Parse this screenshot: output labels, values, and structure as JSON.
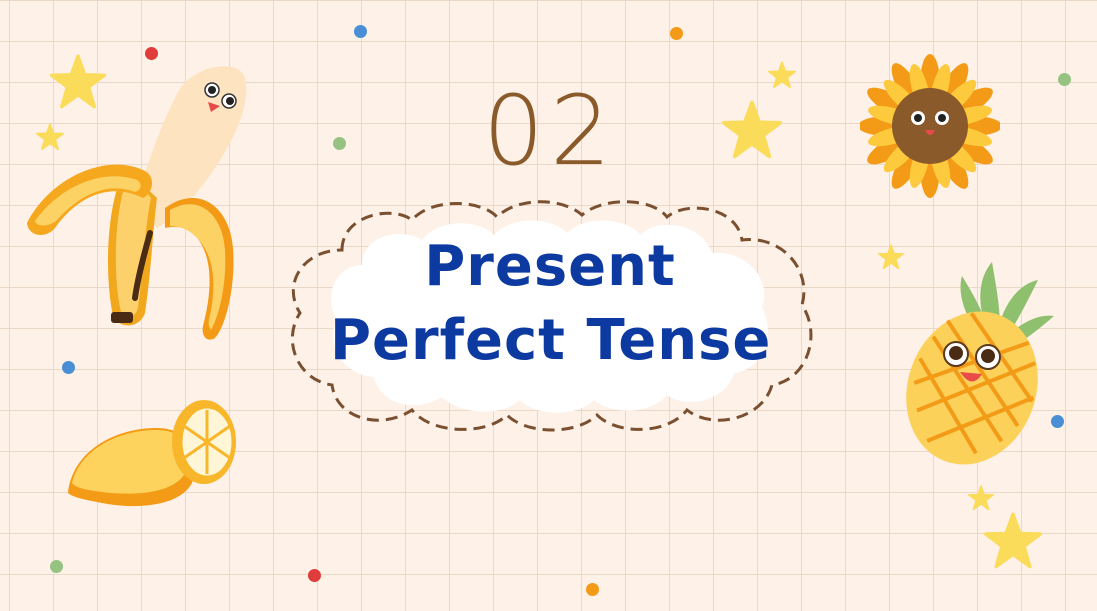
{
  "slide": {
    "section_number": "02",
    "title_line_1": "Present",
    "title_line_2": "Perfect Tense"
  },
  "colors": {
    "background": "#fdf1e8",
    "grid_line": "#ead9c9",
    "number": "#8b5a2b",
    "title": "#0d3aa0",
    "cloud": "#ffffff",
    "cloud_outline": "#7a5030",
    "star": "#fbdc5a",
    "dot_red": "#e03c3c",
    "dot_blue": "#4a8fd6",
    "dot_orange": "#f39a17",
    "dot_green": "#96c282"
  },
  "decorations": {
    "left": [
      "banana-icon",
      "lemon-icon"
    ],
    "right": [
      "sunflower-icon",
      "pineapple-icon"
    ]
  }
}
